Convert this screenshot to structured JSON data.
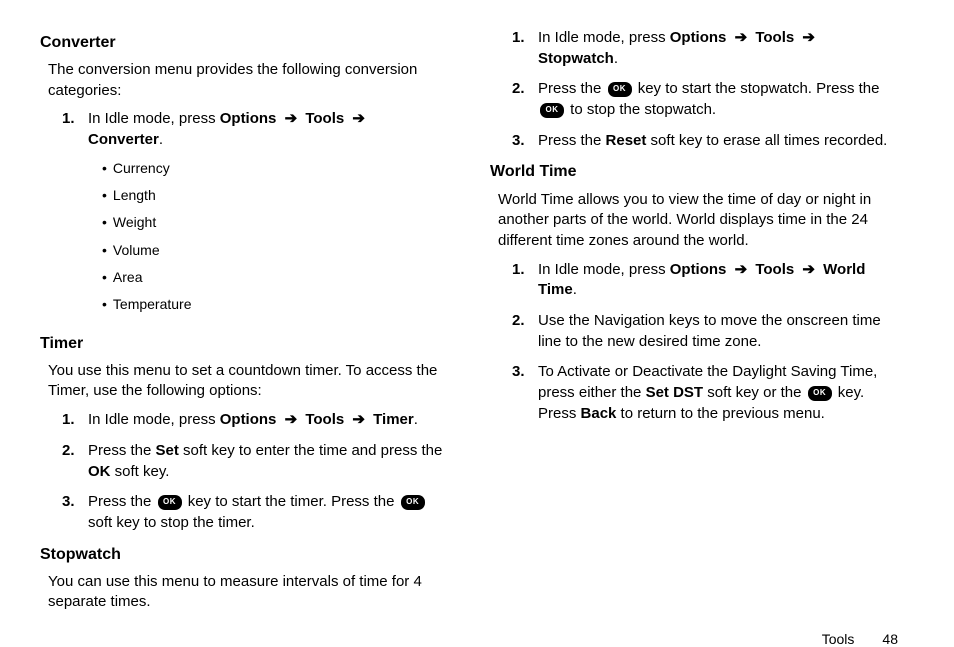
{
  "left": {
    "converter": {
      "heading": "Converter",
      "intro": "The conversion menu provides the following conversion categories:",
      "step1_pre": "In Idle mode, press ",
      "step1_opt": "Options",
      "step1_tools": "Tools",
      "step1_dest": "Converter",
      "bullets": [
        "Currency",
        "Length",
        "Weight",
        "Volume",
        "Area",
        "Temperature"
      ]
    },
    "timer": {
      "heading": "Timer",
      "intro": "You use this menu to set a countdown timer. To access the Timer, use the following options:",
      "s1_pre": "In Idle mode, press ",
      "s1_opt": "Options",
      "s1_tools": "Tools",
      "s1_dest": "Timer",
      "s2_a": "Press the ",
      "s2_set": "Set",
      "s2_b": " soft key to enter the time and press the ",
      "s2_ok": "OK",
      "s2_c": " soft key.",
      "s3_a": "Press the ",
      "s3_b": " key to start the timer. Press the ",
      "s3_c": " soft key to stop the timer."
    },
    "stopwatch": {
      "heading": "Stopwatch",
      "intro": "You can use this menu to measure intervals of time for 4 separate times."
    }
  },
  "right": {
    "stopwatch_steps": {
      "s1_pre": "In Idle mode, press ",
      "s1_opt": "Options",
      "s1_tools": "Tools",
      "s1_dest": "Stopwatch",
      "s2_a": "Press the ",
      "s2_b": " key to start the stopwatch. Press the ",
      "s2_c": " to stop the stopwatch.",
      "s3_a": "Press the ",
      "s3_reset": "Reset",
      "s3_b": " soft key to erase all times recorded."
    },
    "world": {
      "heading": "World Time",
      "intro": "World Time allows you to view the time of day or night in another parts of the world. World displays time in the 24 different time zones around the world.",
      "s1_pre": "In Idle mode, press ",
      "s1_opt": "Options",
      "s1_tools": "Tools",
      "s1_dest": "World Time",
      "s2": "Use the Navigation keys to move the onscreen time line to the new desired time zone.",
      "s3_a": "To Activate or Deactivate the Daylight Saving Time, press either the ",
      "s3_set": "Set DST",
      "s3_b": " soft key or the ",
      "s3_c": " key. Press ",
      "s3_back": "Back",
      "s3_d": " to return to the previous menu."
    }
  },
  "footer": {
    "section": "Tools",
    "page": "48"
  },
  "arrow": "➔",
  "ok_label": "OK",
  "nums": {
    "n1": "1.",
    "n2": "2.",
    "n3": "3."
  },
  "period": "."
}
